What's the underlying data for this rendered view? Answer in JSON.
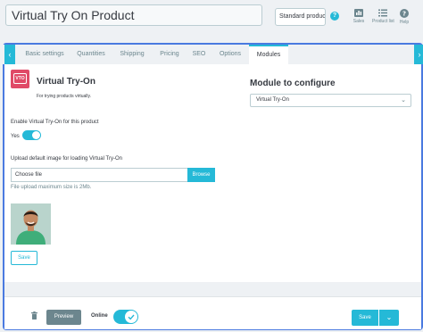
{
  "header": {
    "product_name": "Virtual Try On Product",
    "product_type": "Standard product",
    "help_marker": "?",
    "buttons": [
      {
        "label": "Sales",
        "icon": "bar-chart-icon"
      },
      {
        "label": "Product list",
        "icon": "list-icon"
      },
      {
        "label": "Help",
        "icon": "help-icon"
      }
    ]
  },
  "tabs": {
    "left_arrow": "‹",
    "right_arrow": "›",
    "items": [
      {
        "label": "Basic settings"
      },
      {
        "label": "Quantities"
      },
      {
        "label": "Shipping"
      },
      {
        "label": "Pricing"
      },
      {
        "label": "SEO"
      },
      {
        "label": "Options"
      },
      {
        "label": "Modules",
        "active": true
      }
    ]
  },
  "module": {
    "logo_text": "VTO",
    "name": "Virtual Try-On",
    "description": "For trying products virtually.",
    "configure_title": "Module to configure",
    "configure_value": "Virtual Try-On",
    "enable_label": "Enable Virtual Try-On for this product",
    "enable_state": "Yes",
    "upload_label": "Upload default image for loading Virtual Try-On",
    "file_placeholder": "Choose file",
    "browse_label": "Browse",
    "upload_hint": "File upload maximum size is 2Mb.",
    "save_label": "Save"
  },
  "footer": {
    "preview_label": "Preview",
    "online_label": "Online",
    "save_label": "Save"
  },
  "colors": {
    "accent": "#25b9d7",
    "frame": "#4a7ae0",
    "logo": "#e04a67"
  }
}
